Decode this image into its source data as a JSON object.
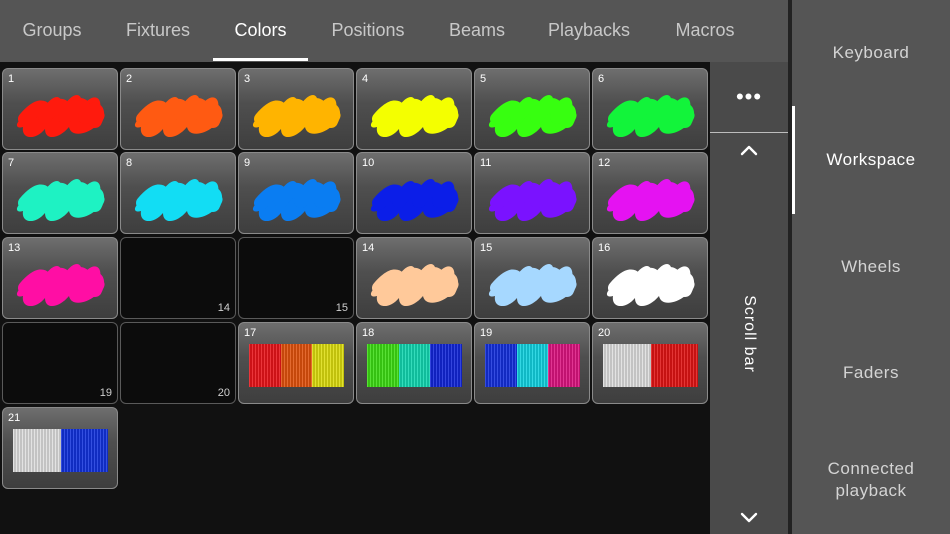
{
  "tabs": [
    {
      "label": "Groups",
      "active": false
    },
    {
      "label": "Fixtures",
      "active": false
    },
    {
      "label": "Colors",
      "active": true
    },
    {
      "label": "Positions",
      "active": false
    },
    {
      "label": "Beams",
      "active": false
    },
    {
      "label": "Playbacks",
      "active": false
    },
    {
      "label": "Macros",
      "active": false
    }
  ],
  "tiles": [
    {
      "number": "1",
      "kind": "scribble",
      "color": "#ff1a0d"
    },
    {
      "number": "2",
      "kind": "scribble",
      "color": "#ff5a12"
    },
    {
      "number": "3",
      "kind": "scribble",
      "color": "#ffb400"
    },
    {
      "number": "4",
      "kind": "scribble",
      "color": "#f4ff00"
    },
    {
      "number": "5",
      "kind": "scribble",
      "color": "#37ff10"
    },
    {
      "number": "6",
      "kind": "scribble",
      "color": "#12f43a"
    },
    {
      "number": "7",
      "kind": "scribble",
      "color": "#1ef2c3"
    },
    {
      "number": "8",
      "kind": "scribble",
      "color": "#12ddf4"
    },
    {
      "number": "9",
      "kind": "scribble",
      "color": "#0a7df2"
    },
    {
      "number": "10",
      "kind": "scribble",
      "color": "#0b1ee8"
    },
    {
      "number": "11",
      "kind": "scribble",
      "color": "#7a12ff"
    },
    {
      "number": "12",
      "kind": "scribble",
      "color": "#e512f2"
    },
    {
      "number": "13",
      "kind": "scribble",
      "color": "#ff0ea4"
    },
    {
      "number": "14",
      "kind": "empty"
    },
    {
      "number": "15",
      "kind": "empty"
    },
    {
      "number": "14",
      "kind": "scribble",
      "color": "#ffc99a"
    },
    {
      "number": "15",
      "kind": "scribble",
      "color": "#a6d8ff"
    },
    {
      "number": "16",
      "kind": "scribble",
      "color": "#ffffff"
    },
    {
      "number": "19",
      "kind": "empty"
    },
    {
      "number": "20",
      "kind": "empty"
    },
    {
      "number": "17",
      "kind": "bars",
      "colors": [
        "#e8141a",
        "#e0520e",
        "#dcdc0f"
      ]
    },
    {
      "number": "18",
      "kind": "bars",
      "colors": [
        "#3ddc14",
        "#12d6b0",
        "#1226d8"
      ]
    },
    {
      "number": "19",
      "kind": "bars",
      "colors": [
        "#1430dc",
        "#12d2e0",
        "#dc1480"
      ]
    },
    {
      "number": "20",
      "kind": "bars",
      "colors": [
        "#dedede",
        "#e01414"
      ]
    },
    {
      "number": "21",
      "kind": "bars",
      "colors": [
        "#dedede",
        "#1232dc"
      ]
    }
  ],
  "scrollbar": {
    "more_label": "•••",
    "label": "Scroll bar"
  },
  "sidebar": {
    "items": [
      {
        "label": "Keyboard",
        "active": false
      },
      {
        "label": "Workspace",
        "active": true
      },
      {
        "label": "Wheels",
        "active": false
      },
      {
        "label": "Faders",
        "active": false
      },
      {
        "label": "Connected\nplayback",
        "active": false
      }
    ]
  }
}
